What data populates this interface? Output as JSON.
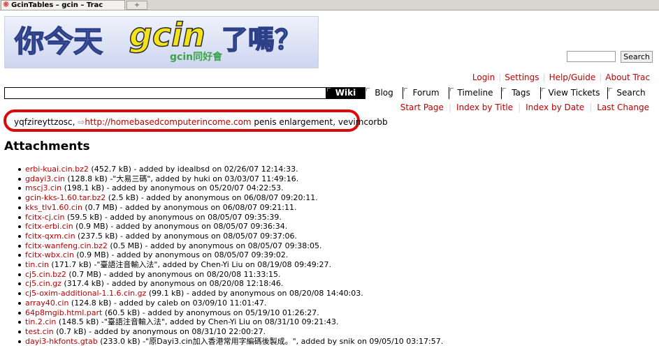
{
  "browser": {
    "tab_title": "GcinTables – gcin – Trac",
    "new_tab_glyph": "+"
  },
  "search": {
    "button": "Search"
  },
  "metanav": [
    "Login",
    "Settings",
    "Help/Guide",
    "About Trac"
  ],
  "mainnav": [
    {
      "label": "Wiki",
      "active": true
    },
    {
      "label": "Blog",
      "active": false
    },
    {
      "label": "Forum",
      "active": false
    },
    {
      "label": "Timeline",
      "active": false
    },
    {
      "label": "Tags",
      "active": false
    },
    {
      "label": "View Tickets",
      "active": false
    },
    {
      "label": "Search",
      "active": false
    }
  ],
  "ctxnav": [
    "Start Page",
    "Index by Title",
    "Index by Date",
    "Last Change"
  ],
  "wiki": {
    "prefix": "yqfzireyttzosc, ",
    "link": "http://homebasedcomputerincome.com",
    "suffix": " penis enlargement, vevimcorbb"
  },
  "attachments_heading": "Attachments",
  "attachments": [
    {
      "file": "erbi-kuai.cin.bz2",
      "info": " (452.7 kB) - added by idealbsd on 02/26/07 12:14:33."
    },
    {
      "file": "gdayi3.cin",
      "info": " (128.8 kB) -\"大易三碼\", added by huki on 03/03/07 11:49:16."
    },
    {
      "file": "mscj3.cin",
      "info": " (198.1 kB) - added by anonymous on 05/20/07 04:22:53."
    },
    {
      "file": "gcin-kks-1.60.tar.bz2",
      "info": " (2.5 kB) - added by anonymous on 06/08/07 09:20:11."
    },
    {
      "file": "kks_tlv1.60.cin",
      "info": " (0.7 MB) - added by anonymous on 06/08/07 09:21:11."
    },
    {
      "file": "fcitx-cj.cin",
      "info": " (59.5 kB) - added by anonymous on 08/05/07 09:35:39."
    },
    {
      "file": "fcitx-erbi.cin",
      "info": " (0.9 MB) - added by anonymous on 08/05/07 09:36:34."
    },
    {
      "file": "fcitx-qxm.cin",
      "info": " (237.5 kB) - added by anonymous on 08/05/07 09:37:06."
    },
    {
      "file": "fcitx-wanfeng.cin.bz2",
      "info": " (0.5 MB) - added by anonymous on 08/05/07 09:38:05."
    },
    {
      "file": "fcitx-wbx.cin",
      "info": " (0.9 MB) - added by anonymous on 08/05/07 09:39:02."
    },
    {
      "file": "tin.cin",
      "info": " (171.7 kB) -\"臺語注音輸入法\", added by Chen-Yi Liu on 08/19/08 09:49:27."
    },
    {
      "file": "cj5.cin.bz2",
      "info": " (0.7 MB) - added by anonymous on 08/20/08 11:33:15."
    },
    {
      "file": "cj5.cin.gz",
      "info": " (317.4 kB) - added by anonymous on 08/20/08 12:18:46."
    },
    {
      "file": "cj5-oxim-additional-1.1.6.cin.gz",
      "info": " (99.1 kB) - added by anonymous on 08/20/08 14:40:03."
    },
    {
      "file": "array40.cin",
      "info": " (124.8 kB) - added by caleb on 03/09/10 11:01:47."
    },
    {
      "file": "64p8mgib.html.part",
      "info": " (60.5 kB) - added by anonymous on 05/19/10 01:26:27."
    },
    {
      "file": "tin.2.cin",
      "info": " (148.5 kB) -\"臺語注音輸入法\", added by Chen-Yi Liu on 08/31/10 09:21:43."
    },
    {
      "file": "test.cin",
      "info": " (0.7 kB) - added by anonymous on 08/31/10 22:00:27."
    },
    {
      "file": "dayi3-hkfonts.gtab",
      "info": " (233.0 kB) -\"原Dayi3.cin加入香港常用字編碼後製成。\", added by snik on 09/05/10 03:17:57."
    }
  ],
  "logo": {
    "text_left": "你今天",
    "text_brand": "gcin",
    "text_sub": "gcin同好會",
    "text_right": "了嗎？"
  }
}
